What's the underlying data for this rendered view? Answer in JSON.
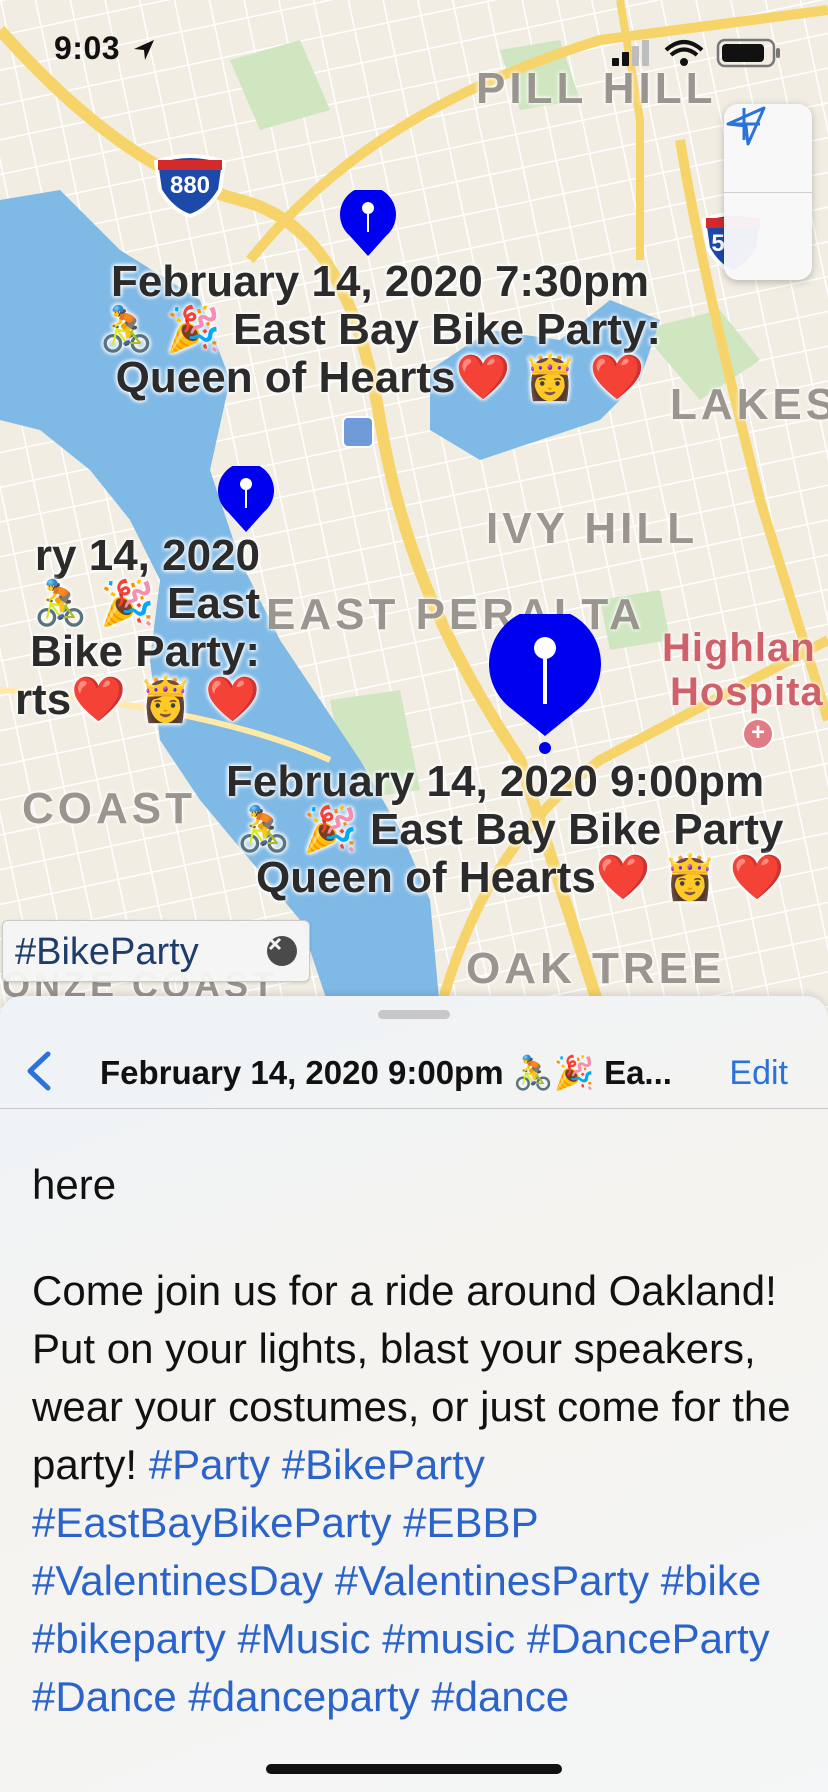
{
  "status_bar": {
    "time": "9:03"
  },
  "map": {
    "highway_shields": [
      "880",
      "5"
    ],
    "area_labels": [
      "PILL HILL",
      "LAKES",
      "IVY HILL",
      "EAST PERALTA",
      "COAST",
      "OAK TREE",
      "ONZE COAST",
      "Highlan",
      "Hospita"
    ],
    "pins": [
      {
        "line1": "February 14, 2020 7:30pm",
        "line2": "🚴 🎉  East Bay Bike Party:",
        "line3": "Queen of Hearts❤️ 👸 ❤️"
      },
      {
        "line1": "ry 14, 2020",
        "line2": "🚴 🎉  East",
        "line3": "Bike Party:",
        "line4": "rts❤️ 👸 ❤️"
      },
      {
        "line1": "February 14, 2020 9:00pm",
        "line2": "🚴 🎉  East Bay Bike Party",
        "line3": "Queen of Hearts❤️ 👸 ❤️"
      }
    ]
  },
  "controls": {
    "locate_icon": "location-arrow-icon",
    "zoom_in_icon": "plus-icon"
  },
  "filter": {
    "chip_text": "#BikeParty",
    "clear_icon": "clear-x-icon"
  },
  "sheet": {
    "title": "February 14, 2020 9:00pm 🚴🎉 Ea...",
    "edit_label": "Edit",
    "paragraph1": "here",
    "paragraph2_text": "Come join us for a ride around Oakland! Put on your lights, blast your speakers, wear your costumes, or just come for the party! ",
    "hashtags": "#Party #BikeParty #EastBayBikeParty #EBBP #ValentinesDay #ValentinesParty #bike #bikeparty #Music #music #DanceParty #Dance #danceparty #dance"
  },
  "colors": {
    "pin": "#0000f0",
    "link": "#2a63c9",
    "water": "#7fb9e6",
    "park": "#cfe6c0",
    "road": "#f6d46a"
  }
}
